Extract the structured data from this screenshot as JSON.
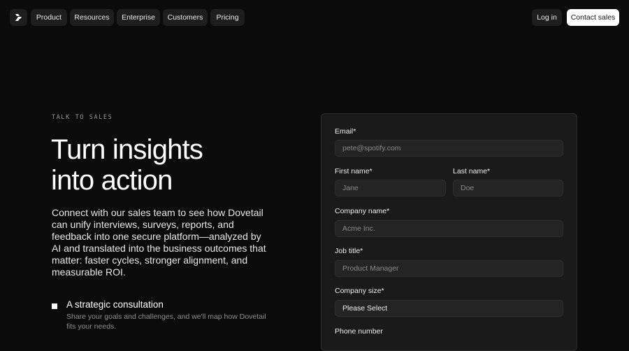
{
  "nav": {
    "items": [
      "Product",
      "Resources",
      "Enterprise",
      "Customers",
      "Pricing"
    ],
    "login": "Log in",
    "contact": "Contact sales"
  },
  "hero": {
    "eyebrow": "TALK TO SALES",
    "title_line1": "Turn insights",
    "title_line2": "into action",
    "lead": "Connect with our sales team to see how Dovetail can unify interviews, surveys, reports, and feedback into one secure platform—analyzed by AI and translated into the business outcomes that matter: faster cycles, stronger alignment, and measurable ROI.",
    "bullets": [
      {
        "title": "A strategic consultation",
        "desc": "Share your goals and challenges, and we'll map how Dovetail fits your needs."
      }
    ]
  },
  "form": {
    "email": {
      "label": "Email*",
      "placeholder": "pete@spotify.com"
    },
    "first_name": {
      "label": "First name*",
      "placeholder": "Jane"
    },
    "last_name": {
      "label": "Last name*",
      "placeholder": "Doe"
    },
    "company": {
      "label": "Company name*",
      "placeholder": "Acme Inc."
    },
    "job": {
      "label": "Job title*",
      "placeholder": "Product Manager"
    },
    "size": {
      "label": "Company size*",
      "value": "Please Select"
    },
    "phone": {
      "label": "Phone number"
    }
  }
}
